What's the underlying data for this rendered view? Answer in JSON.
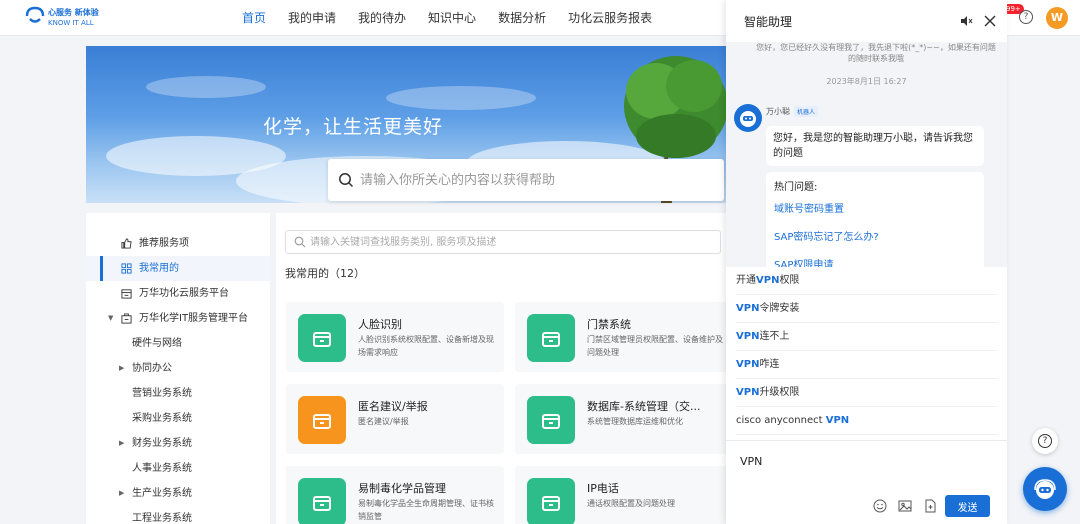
{
  "brand": {
    "line1": "心服务 新体验",
    "line2": "KNOW IT ALL"
  },
  "nav": [
    {
      "label": "首页",
      "active": true
    },
    {
      "label": "我的申请"
    },
    {
      "label": "我的待办"
    },
    {
      "label": "知识中心"
    },
    {
      "label": "数据分析"
    },
    {
      "label": "功化云服务报表"
    }
  ],
  "header": {
    "badge": "99+",
    "avatar_letter": "W"
  },
  "banner": {
    "slogan": "化学，让生活更美好",
    "search_placeholder": "请输入你所关心的内容以获得帮助"
  },
  "sidebar": {
    "items": [
      {
        "label": "推荐服务项",
        "icon": "thumb-up-icon"
      },
      {
        "label": "我常用的",
        "icon": "grid-icon",
        "active": true
      },
      {
        "label": "万华功化云服务平台",
        "icon": "calendar-icon"
      },
      {
        "label": "万华化学IT服务管理平台",
        "icon": "bag-icon",
        "expanded": true
      },
      {
        "label": "硬件与网络"
      },
      {
        "label": "协同办公",
        "collapsed": true
      },
      {
        "label": "营销业务系统"
      },
      {
        "label": "采购业务系统"
      },
      {
        "label": "财务业务系统",
        "collapsed": true
      },
      {
        "label": "人事业务系统"
      },
      {
        "label": "生产业务系统",
        "collapsed": true
      },
      {
        "label": "工程业务系统"
      }
    ]
  },
  "main": {
    "search_placeholder": "请输入关键词查找服务类别, 服务项及描述",
    "section_title": "我常用的（12）",
    "cards": [
      {
        "title": "人脸识别",
        "desc": "人脸识别系统权限配置、设备新增及现场需求响应",
        "color": "#2dbd8a"
      },
      {
        "title": "门禁系统",
        "desc": "门禁区域管理员权限配置、设备维护及问题处理",
        "color": "#2dbd8a"
      },
      {
        "title": "匿名建议/举报",
        "desc": "匿名建议/举报",
        "color": "#f7941d"
      },
      {
        "title": "数据库-系统管理（交...",
        "desc": "系统管理数据库运维和优化",
        "color": "#2dbd8a"
      },
      {
        "title": "易制毒化学品管理",
        "desc": "易制毒化学品全生命周期管理、证书核销监管",
        "color": "#2dbd8a"
      },
      {
        "title": "IP电话",
        "desc": "通话权限配置及问题处理",
        "color": "#2dbd8a"
      }
    ]
  },
  "chat": {
    "title": "智能助理",
    "old_message": "您好，您已经好久没有理我了，我先退下啦(*_*)~~，如果还有问题的随时联系我哦",
    "timestamp": "2023年8月1日 16:27",
    "bot_name": "万小聪",
    "bot_tag": "机器人",
    "greeting": "您好，我是您的智能助理万小聪，请告诉我您的问题",
    "hot_title": "热门问题:",
    "hot_items": [
      "域账号密码重置",
      "SAP密码忘记了怎么办?",
      "SAP权限申请"
    ],
    "suggestions": [
      {
        "pre": "开通",
        "hl": "VPN",
        "post": "权限"
      },
      {
        "pre": "",
        "hl": "VPN",
        "post": "令牌安装"
      },
      {
        "pre": "",
        "hl": "VPN",
        "post": "连不上"
      },
      {
        "pre": "",
        "hl": "VPN",
        "post": "咋连"
      },
      {
        "pre": "",
        "hl": "VPN",
        "post": "升级权限"
      },
      {
        "pre": "cisco anyconnect ",
        "hl": "VPN",
        "post": ""
      }
    ],
    "input_value": "VPN",
    "send_label": "发送"
  },
  "float": {
    "help": "?"
  }
}
